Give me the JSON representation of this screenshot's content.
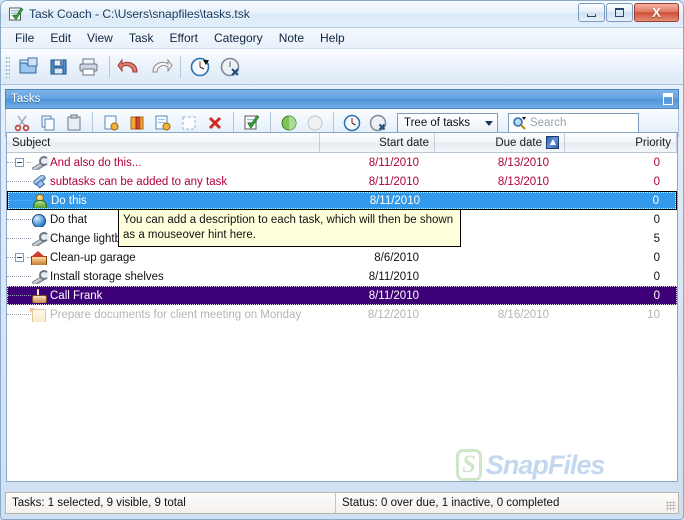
{
  "window": {
    "title": "Task Coach - C:\\Users\\snapfiles\\tasks.tsk",
    "app_icon": "task-coach-icon",
    "buttons": {
      "minimize": "–",
      "maximize": "□",
      "close": "X"
    }
  },
  "menubar": {
    "items": [
      {
        "label": "File"
      },
      {
        "label": "Edit"
      },
      {
        "label": "View"
      },
      {
        "label": "Task"
      },
      {
        "label": "Effort"
      },
      {
        "label": "Category"
      },
      {
        "label": "Note"
      },
      {
        "label": "Help"
      }
    ]
  },
  "main_toolbar": {
    "buttons": [
      {
        "name": "open-file-icon"
      },
      {
        "name": "save-file-icon"
      },
      {
        "name": "print-icon"
      },
      {
        "name": "undo-icon"
      },
      {
        "name": "redo-icon"
      },
      {
        "name": "start-effort-clock-icon"
      },
      {
        "name": "stop-effort-clock-icon"
      }
    ]
  },
  "panel": {
    "caption": "Tasks",
    "float_icon": "restore-panel-icon"
  },
  "task_toolbar": {
    "buttons": [
      {
        "name": "cut-icon"
      },
      {
        "name": "copy-icon"
      },
      {
        "name": "paste-icon"
      },
      {
        "name": "new-task-icon"
      },
      {
        "name": "new-subtask-icon"
      },
      {
        "name": "edit-task-icon"
      },
      {
        "name": "mark-complete-icon"
      },
      {
        "name": "delete-task-icon"
      },
      {
        "name": "new-note-icon"
      },
      {
        "name": "start-tracking-icon"
      },
      {
        "name": "stop-tracking-icon"
      },
      {
        "name": "start-clock-icon"
      },
      {
        "name": "stop-clock-icon"
      }
    ],
    "view_select": {
      "value": "Tree of tasks"
    },
    "search": {
      "placeholder": "Search",
      "value": "",
      "icon": "search-icon"
    }
  },
  "table": {
    "columns": [
      {
        "key": "subject",
        "label": "Subject"
      },
      {
        "key": "start",
        "label": "Start date"
      },
      {
        "key": "due",
        "label": "Due date",
        "sort_icon": "sort-ascending-icon"
      },
      {
        "key": "priority",
        "label": "Priority"
      }
    ],
    "rows": [
      {
        "subject": "And also do this...",
        "start": "8/11/2010",
        "due": "8/13/2010",
        "priority": "0",
        "icon": "wrench-icon",
        "depth": 0,
        "expander": "collapse",
        "state": "overdue"
      },
      {
        "subject": "subtasks can be added to any task",
        "start": "8/11/2010",
        "due": "8/13/2010",
        "priority": "0",
        "icon": "clip-icon",
        "depth": 1,
        "expander": "none",
        "state": "overdue"
      },
      {
        "subject": "Do this",
        "start": "8/11/2010",
        "due": "",
        "priority": "0",
        "icon": "person-icon",
        "depth": 1,
        "expander": "none",
        "state": "selected"
      },
      {
        "subject": "Do that",
        "start": "",
        "due": "",
        "priority": "0",
        "icon": "circle-icon",
        "depth": 1,
        "expander": "none",
        "state": "normal"
      },
      {
        "subject": "Change lightbulb",
        "start": "",
        "due": "",
        "priority": "5",
        "icon": "wrench-icon",
        "depth": 1,
        "expander": "none",
        "state": "normal"
      },
      {
        "subject": "Clean-up garage",
        "start": "8/6/2010",
        "due": "",
        "priority": "0",
        "icon": "house-icon",
        "depth": 0,
        "expander": "collapse",
        "state": "normal"
      },
      {
        "subject": "Install storage shelves",
        "start": "8/11/2010",
        "due": "",
        "priority": "0",
        "icon": "wrench-icon",
        "depth": 1,
        "expander": "none",
        "state": "normal"
      },
      {
        "subject": "Call Frank",
        "start": "8/11/2010",
        "due": "",
        "priority": "0",
        "icon": "cake-icon",
        "depth": 1,
        "expander": "none",
        "state": "purple"
      },
      {
        "subject": "Prepare documents for client meeting on Monday",
        "start": "8/12/2010",
        "due": "8/16/2010",
        "priority": "10",
        "icon": "note-icon",
        "depth": 1,
        "expander": "none",
        "state": "inactive"
      }
    ]
  },
  "tooltip": {
    "text": "You can add a description to each task, which will then be shown as a mouseover hint here."
  },
  "watermark": {
    "badge": "S",
    "text": "SnapFiles"
  },
  "statusbar": {
    "tasks": "Tasks: 1 selected, 9 visible, 9 total",
    "status": "Status: 0 over due, 1 inactive, 0 completed"
  },
  "colors": {
    "selection_blue": "#3399ea",
    "purple_row": "#3d0077",
    "overdue_text": "#b0003a",
    "inactive_text": "#b5b5b5",
    "tooltip_bg": "#ffffdc",
    "caption_blue": "#5fa0e0"
  }
}
